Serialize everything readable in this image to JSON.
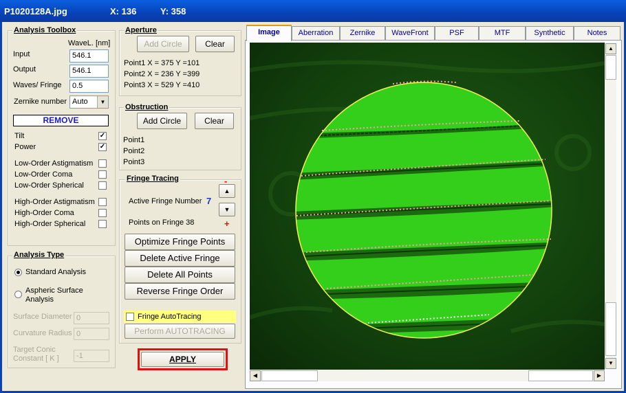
{
  "window": {
    "title": "P1020128A.jpg",
    "x_readout": "X:  136",
    "y_readout": "Y:  358"
  },
  "toolbox": {
    "title": "Analysis Toolbox",
    "wavel_header": "WaveL. [nm]",
    "input_label": "Input",
    "input_value": "546.1",
    "output_label": "Output",
    "output_value": "546.1",
    "waves_label": "Waves/ Fringe",
    "waves_value": "0.5",
    "zernike_label": "Zernike number",
    "zernike_value": "Auto",
    "remove_label": "REMOVE",
    "terms": [
      {
        "label": "Tilt",
        "checked": true
      },
      {
        "label": "Power",
        "checked": true
      },
      {
        "label": "Low-Order  Astigmatism",
        "checked": false
      },
      {
        "label": "Low-Order  Coma",
        "checked": false
      },
      {
        "label": "Low-Order  Spherical",
        "checked": false
      },
      {
        "label": "High-Order  Astigmatism",
        "checked": false
      },
      {
        "label": "High-Order  Coma",
        "checked": false
      },
      {
        "label": "High-Order  Spherical",
        "checked": false
      }
    ]
  },
  "analysis_type": {
    "title": "Analysis Type",
    "standard": "Standard  Analysis",
    "aspheric_1": "Aspheric  Surface",
    "aspheric_2": "Analysis",
    "surface_diameter_label": "Surface Diameter",
    "surface_diameter_value": "0",
    "curvature_radius_label": "Curvature Radius",
    "curvature_radius_value": "0",
    "target_conic_label_1": "Target Conic",
    "target_conic_label_2": "Constant [ K ]",
    "target_conic_value": "-1"
  },
  "aperture": {
    "title": "Aperture",
    "add_circle": "Add Circle",
    "clear": "Clear",
    "p1": "Point1  X =    375   Y =101",
    "p2": "Point2  X =    236   Y =399",
    "p3": "Point3  X =    529   Y =410"
  },
  "obstruction": {
    "title": "Obstruction",
    "add_circle": "Add Circle",
    "clear": "Clear",
    "p1": "Point1",
    "p2": "Point2",
    "p3": "Point3"
  },
  "fringe": {
    "title": "Fringe Tracing",
    "active_label": "Active Fringe Number",
    "active_value": "7",
    "points_label": "Points on  Fringe 38",
    "minus": "-",
    "plus": "+",
    "optimize": "Optimize Fringe Points",
    "delete_active": "Delete Active Fringe",
    "delete_all": "Delete  All  Points",
    "reverse": "Reverse  Fringe Order",
    "autotracing_label": "Fringe AutoTracing",
    "perform": "Perform  AUTOTRACING"
  },
  "apply_label": "APPLY",
  "tabs": [
    "Image",
    "Aberration",
    "Zernike",
    "WaveFront",
    "PSF",
    "MTF",
    "Synthetic",
    "Notes"
  ],
  "colors": {
    "title_blue": "#0842b8",
    "fringe_green": "#2ec41a",
    "apply_border": "#e01010",
    "autotracing_bg": "#ffff80"
  }
}
